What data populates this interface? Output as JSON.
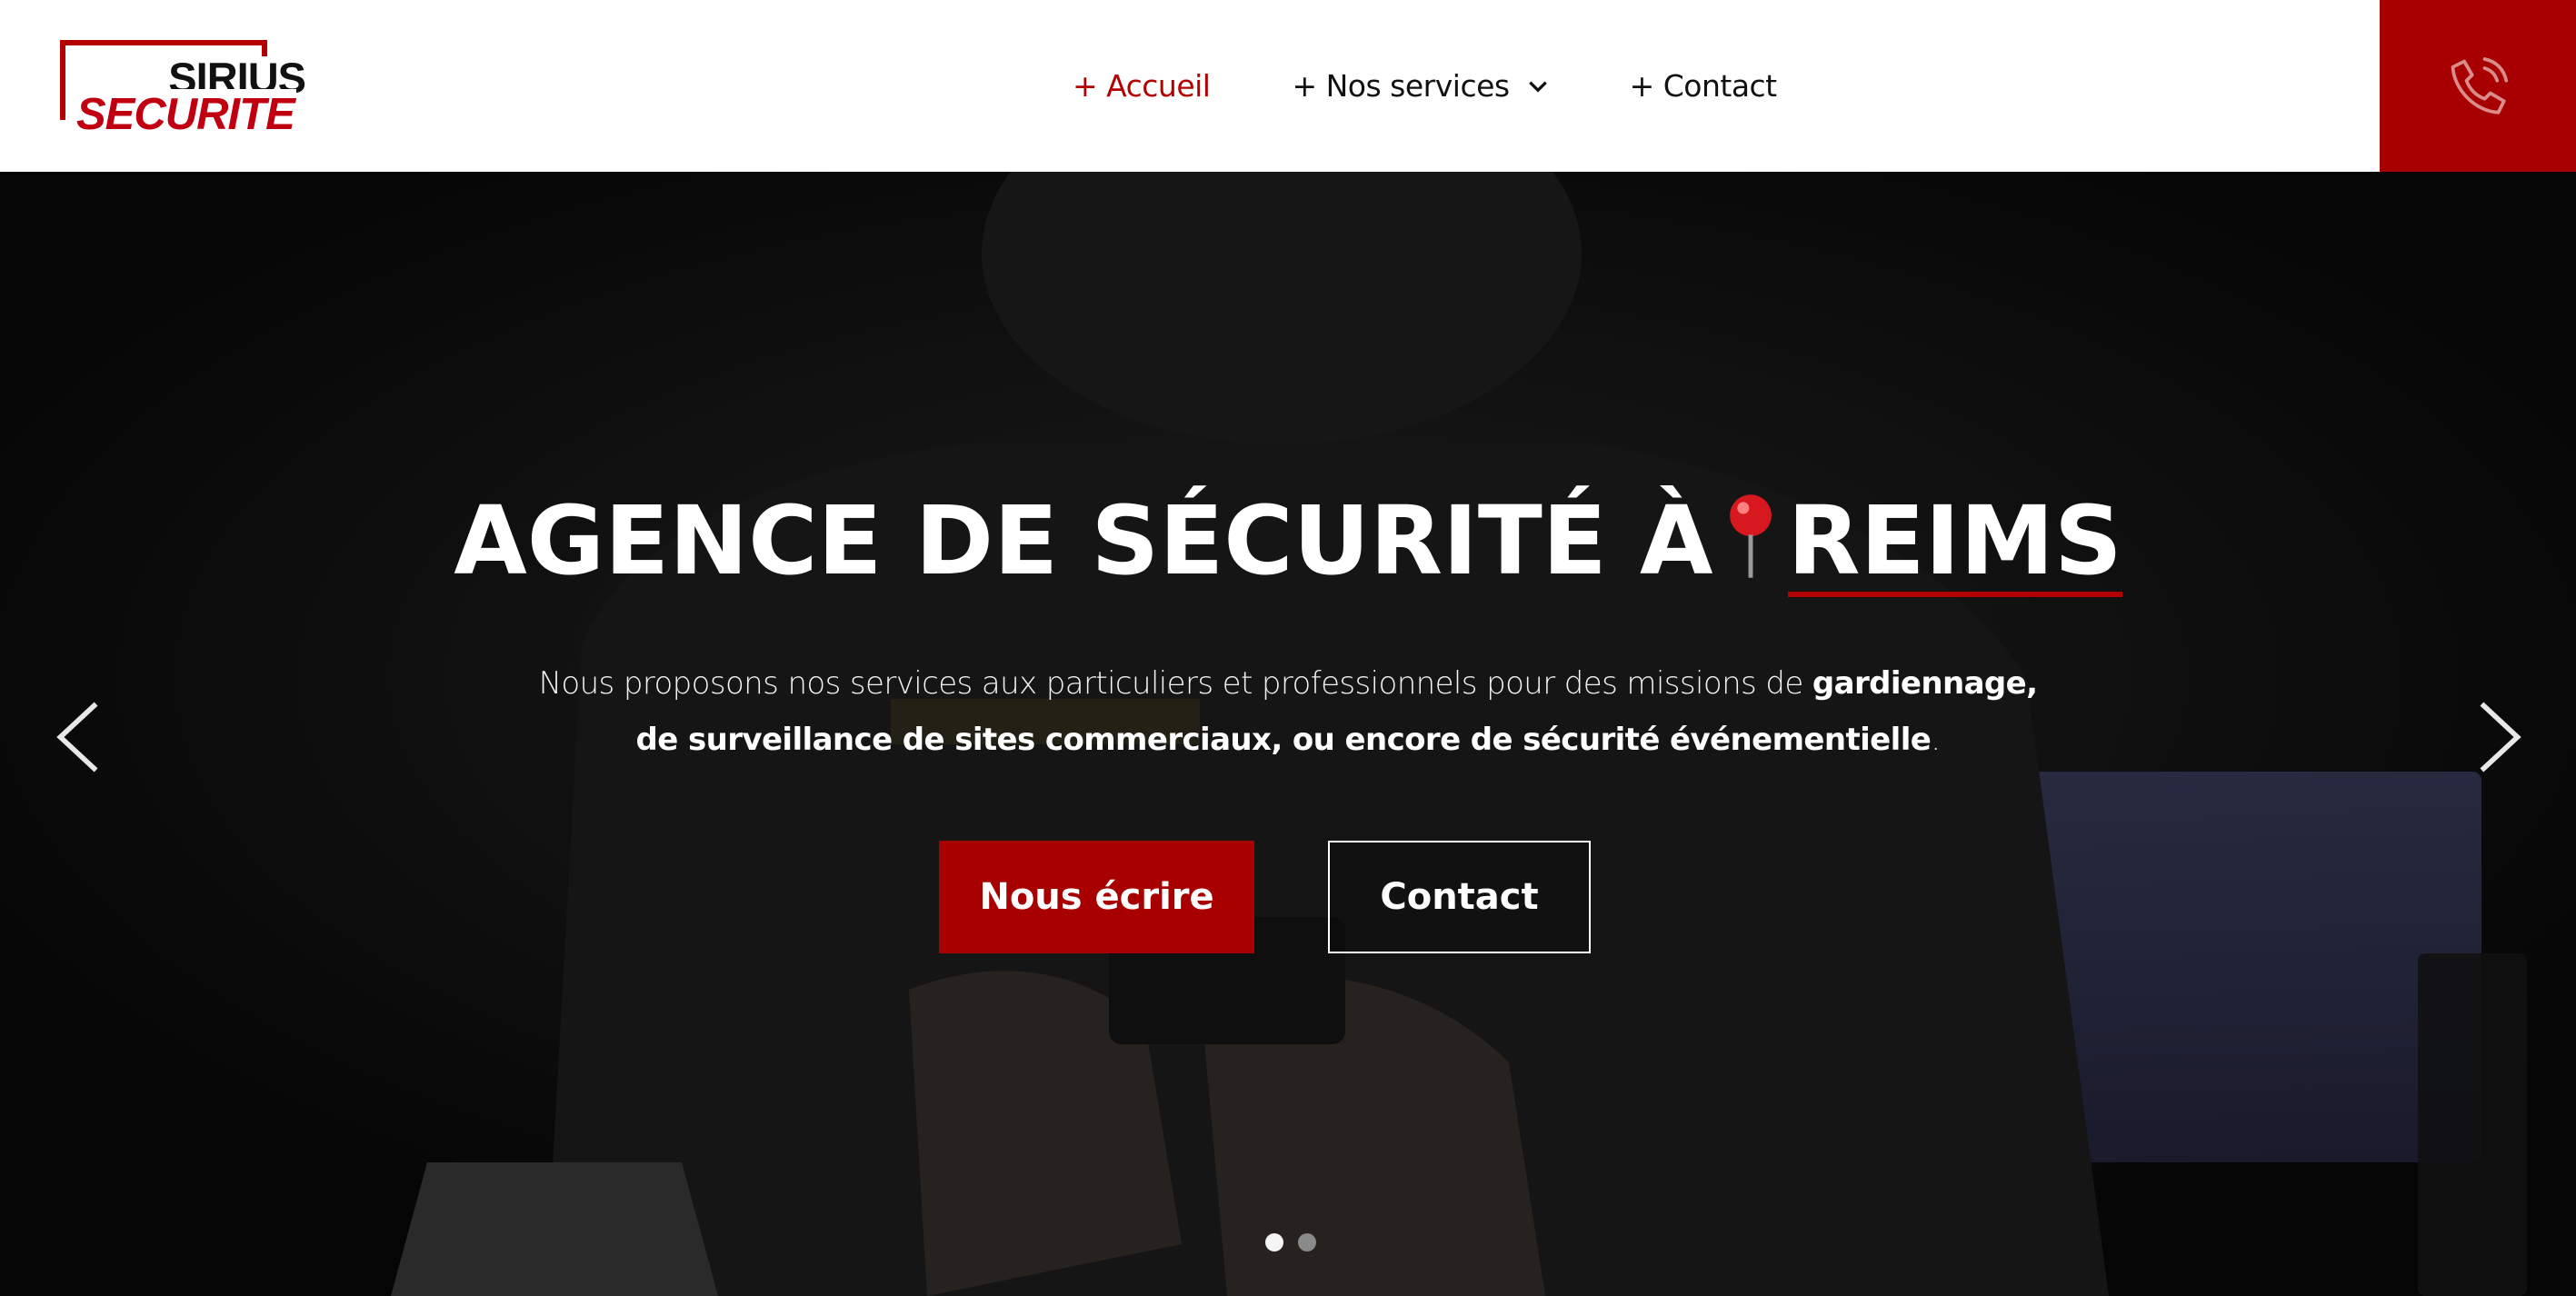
{
  "logo": {
    "line1": "SIRIUS",
    "line2": "SECURITE"
  },
  "nav": {
    "items": [
      {
        "label": "+ Accueil",
        "active": true
      },
      {
        "label": "+ Nos services",
        "dropdown": true
      },
      {
        "label": "+ Contact"
      }
    ]
  },
  "phone": {
    "icon": "phone-icon"
  },
  "hero": {
    "title_prefix": "AGENCE DE SÉCURITÉ À",
    "title_city": "REIMS",
    "pin_icon": "map-pin-icon",
    "desc_light_1": "Nous proposons nos services aux particuliers et professionnels pour des missions de ",
    "desc_bold_1": "gardiennage,",
    "desc_bold_2": "de surveillance de sites commerciaux, ou encore de sécurité événementielle",
    "desc_end": ".",
    "btn_primary": "Nous écrire",
    "btn_secondary": "Contact",
    "slides": 2,
    "active_slide": 1
  },
  "colors": {
    "accent": "#a80000",
    "header_bg": "#ffffff",
    "text_dark": "#111111"
  }
}
